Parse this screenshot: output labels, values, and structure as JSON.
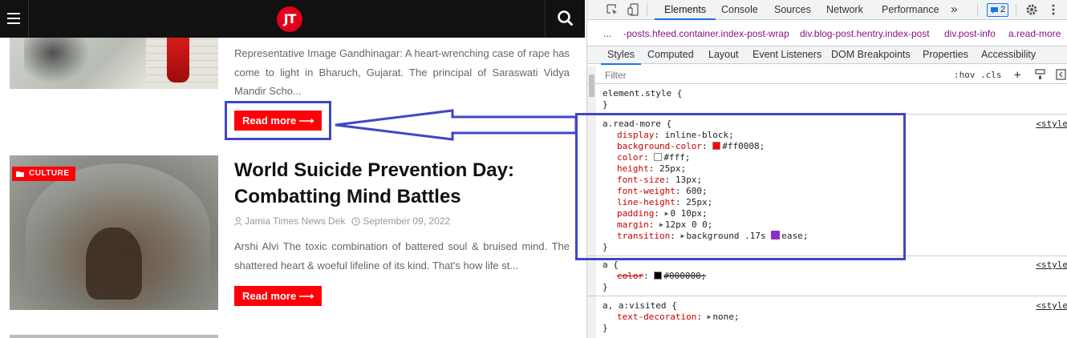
{
  "site": {
    "logo_text": "JT",
    "post1": {
      "excerpt": "Representative Image Gandhinagar:  A heart-wrenching case of rape has come to light in Bharuch, Gujarat. The principal of Saraswati Vidya Mandir Scho...",
      "read_more": "Read more ⟶"
    },
    "post2": {
      "category": "CULTURE",
      "title": "World Suicide Prevention Day: Combatting Mind Battles",
      "author": "Jamia Times News Dek",
      "date": "September 09, 2022",
      "excerpt": "Arshi Alvi The toxic combination of battered soul & bruised mind. The shattered heart & woeful lifeline of its kind. That's how life st...",
      "read_more": "Read more ⟶"
    }
  },
  "devtools": {
    "tabs": [
      "Elements",
      "Console",
      "Sources",
      "Network",
      "Performance"
    ],
    "more_tabs": "»",
    "issues_count": "2",
    "breadcrumbs": {
      "more": "...",
      "items": [
        "-posts.hfeed.container.index-post-wrap",
        "div.blog-post.hentry.index-post",
        "div.post-info",
        "a.read-more"
      ]
    },
    "subtabs": [
      "Styles",
      "Computed",
      "Layout",
      "Event Listeners",
      "DOM Breakpoints",
      "Properties",
      "Accessibility"
    ],
    "filter_placeholder": "Filter",
    "filter_hov": ":hov",
    "filter_cls": ".cls",
    "filter_plus": "+",
    "rules": {
      "element_style": {
        "selector": "element.style {",
        "close": "}"
      },
      "read_more": {
        "selector": "a.read-more {",
        "source": "<style",
        "decls": [
          {
            "prop": "display",
            "value": "inline-block;"
          },
          {
            "prop": "background-color",
            "value": "#ff0008;"
          },
          {
            "prop": "color",
            "value": "#fff;"
          },
          {
            "prop": "height",
            "value": "25px;"
          },
          {
            "prop": "font-size",
            "value": "13px;"
          },
          {
            "prop": "font-weight",
            "value": "600;"
          },
          {
            "prop": "line-height",
            "value": "25px;"
          },
          {
            "prop": "padding",
            "value": "0 10px;"
          },
          {
            "prop": "margin",
            "value": "12px 0 0;"
          },
          {
            "prop": "transition",
            "value_a": "background .17s ",
            "value_b": "ease;"
          }
        ],
        "close": "}"
      },
      "a": {
        "selector": "a {",
        "source": "<style",
        "prop": "color",
        "value": "#000000;",
        "close": "}"
      },
      "a_visited": {
        "selector": "a, a:visited {",
        "source": "<style",
        "prop": "text-decoration",
        "value": "none;",
        "close": "}"
      }
    },
    "colors": {
      "swatch_red": "#ff0008",
      "swatch_white": "#ffffff",
      "swatch_black": "#000000",
      "highlight": "#3f47c4"
    }
  }
}
